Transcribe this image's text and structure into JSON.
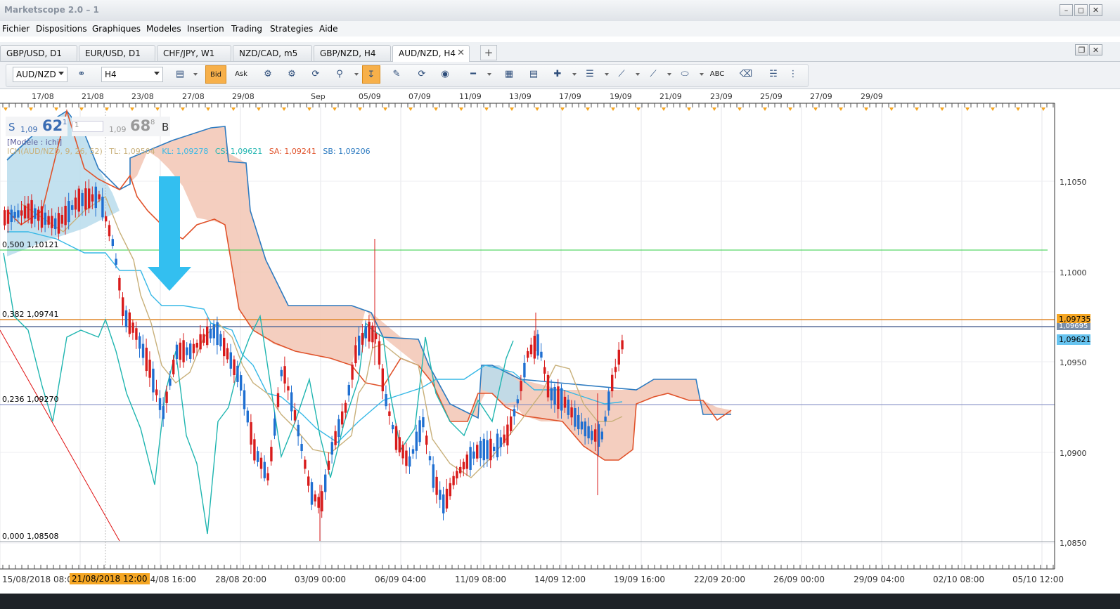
{
  "window": {
    "title": "Marketscope 2.0 – 1"
  },
  "menu": [
    "Fichier",
    "Dispositions",
    "Graphiques",
    "Modeles",
    "Insertion",
    "Trading",
    "Strategies",
    "Aide"
  ],
  "tabs": [
    {
      "label": "GBP/USD, D1"
    },
    {
      "label": "EUR/USD, D1"
    },
    {
      "label": "CHF/JPY, W1"
    },
    {
      "label": "NZD/CAD, m5"
    },
    {
      "label": "GBP/NZD, H4"
    },
    {
      "label": "AUD/NZD, H4",
      "active": true
    }
  ],
  "toolbar": {
    "symbol": "AUD/NZD",
    "timeframe": "H4",
    "bid_label": "Bid",
    "ask_label": "Ask",
    "text_tool_label": "ABC"
  },
  "price_box": {
    "sell_label": "S",
    "sell_prefix": "1,09",
    "sell_big": "62",
    "sell_small": "1",
    "buy_label": "B",
    "buy_prefix": "1,09",
    "buy_big": "68",
    "buy_small": "8",
    "amount": "1"
  },
  "legend": {
    "model": "[Modèle : ichi]",
    "ich": "ICH(AUD/NZD, 9, 26, 52)",
    "tl": "TL: 1,09504",
    "kl": "KL: 1,09278",
    "cs": "CS: 1,09621",
    "sa": "SA: 1,09241",
    "sb": "SB: 1,09206"
  },
  "fib_levels": [
    {
      "label": "0,500 1,10121"
    },
    {
      "label": "0,382 1,09741"
    },
    {
      "label": "0,236 1,09270"
    },
    {
      "label": "0,000 1,08508"
    }
  ],
  "price_tags": [
    {
      "value": "1,09735",
      "color": "#f5a623"
    },
    {
      "value": "1,09695",
      "color": "#7a8ea8"
    },
    {
      "value": "1,09621",
      "color": "#67c4f0"
    }
  ],
  "y_axis": [
    "1,1050",
    "1,1000",
    "1,0950",
    "1,0900",
    "1,0850"
  ],
  "x_axis_top": [
    "17/08",
    "21/08",
    "23/08",
    "27/08",
    "29/08",
    "Sep",
    "05/09",
    "07/09",
    "11/09",
    "13/09",
    "17/09",
    "19/09",
    "21/09",
    "23/09",
    "25/09",
    "27/09",
    "29/09"
  ],
  "x_axis_bottom": [
    "15/08/2018 08:00",
    "21/08/2018 12:00",
    "24/08 16:00",
    "28/08 20:00",
    "03/09 00:00",
    "06/09 04:00",
    "11/09 08:00",
    "14/09 12:00",
    "19/09 16:00",
    "22/09 20:00",
    "26/09 00:00",
    "29/09 04:00",
    "02/10 08:00",
    "05/10 12:00"
  ],
  "cursor_label": "21/08/2018 12:00",
  "colors": {
    "bull": "#1f6fd1",
    "bear": "#d81b1b",
    "tenkan": "#36b8e6",
    "kijun": "#c8b07a",
    "chikou": "#1fb5b0",
    "senkou_a": "#e0522a",
    "senkou_b": "#2c7ac0",
    "cloud_bull": "#b9dcec",
    "cloud_bear": "#f3c9b8",
    "fib_green": "#2ecc40",
    "accent": "#f5a623"
  }
}
